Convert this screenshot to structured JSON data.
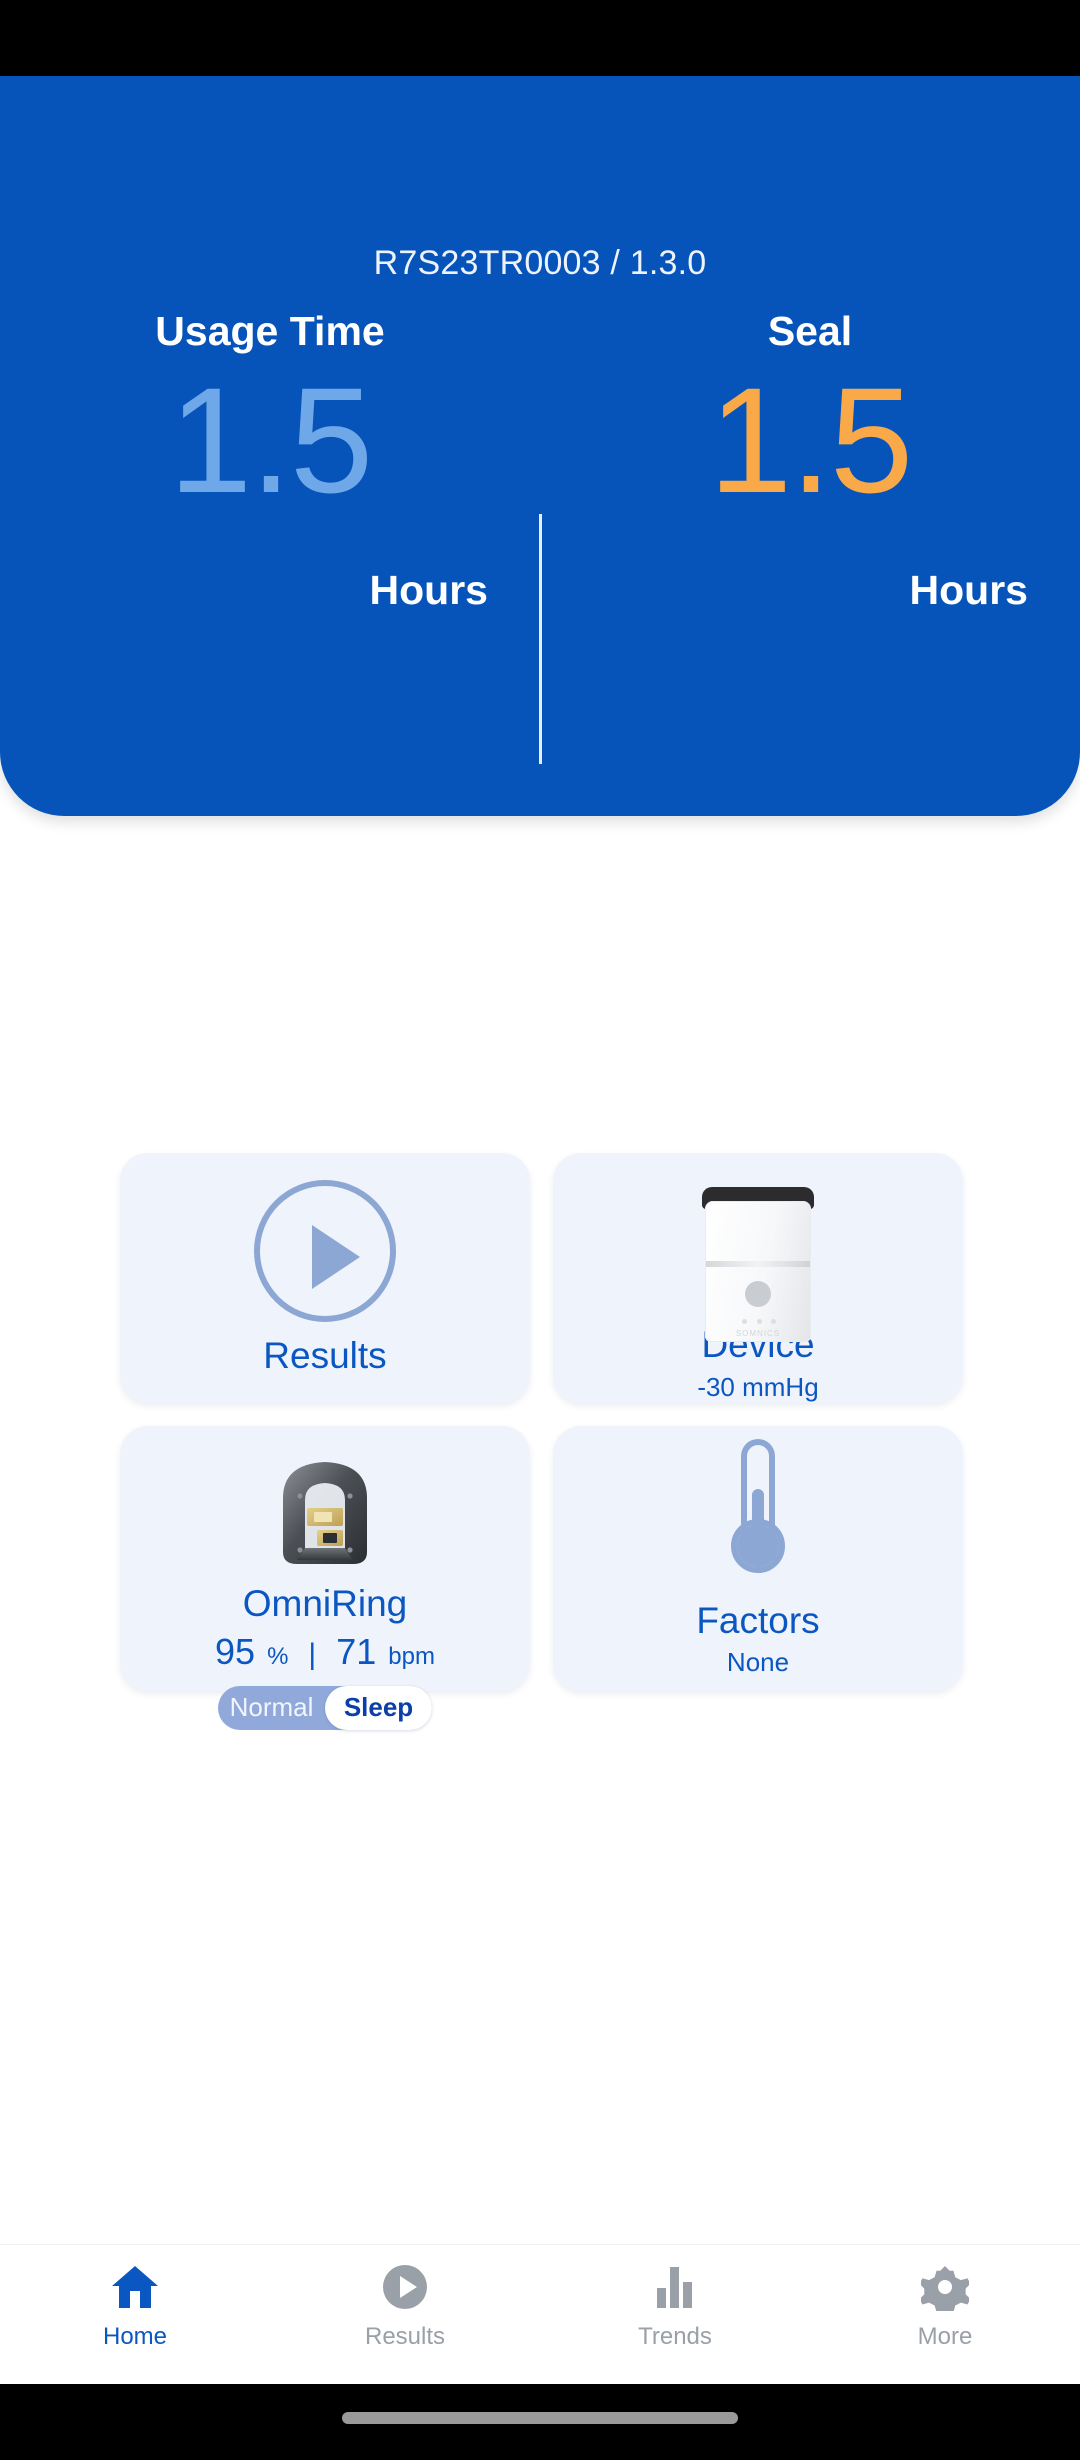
{
  "header": {
    "device_id": "R7S23TR0003 / 1.3.0",
    "stats": [
      {
        "title": "Usage Time",
        "value": "1.5",
        "unit": "Hours",
        "color": "#6FA8E8"
      },
      {
        "title": "Seal",
        "value": "1.5",
        "unit": "Hours",
        "color": "#F9A948"
      }
    ],
    "background_color": "#0654B9"
  },
  "cards": {
    "results": {
      "title": "Results",
      "icon": "play-circle-icon"
    },
    "device": {
      "title": "Device",
      "subtitle": "-30 mmHg",
      "icon": "device-image"
    },
    "omniring": {
      "title": "OmniRing",
      "spo2_value": "95",
      "spo2_unit": "%",
      "separator": "|",
      "hr_value": "71",
      "hr_unit": "bpm",
      "toggle": {
        "options": [
          "Normal",
          "Sleep"
        ],
        "selected": "Sleep"
      },
      "icon": "ring-image"
    },
    "factors": {
      "title": "Factors",
      "subtitle": "None",
      "icon": "thermometer-icon"
    }
  },
  "bottom_nav": {
    "items": [
      {
        "label": "Home",
        "icon": "home-icon",
        "active": true
      },
      {
        "label": "Results",
        "icon": "play-icon",
        "active": false
      },
      {
        "label": "Trends",
        "icon": "bar-chart-icon",
        "active": false
      },
      {
        "label": "More",
        "icon": "gear-icon",
        "active": false
      }
    ],
    "active_color": "#0B57C2",
    "inactive_color": "#9aa0a8"
  }
}
